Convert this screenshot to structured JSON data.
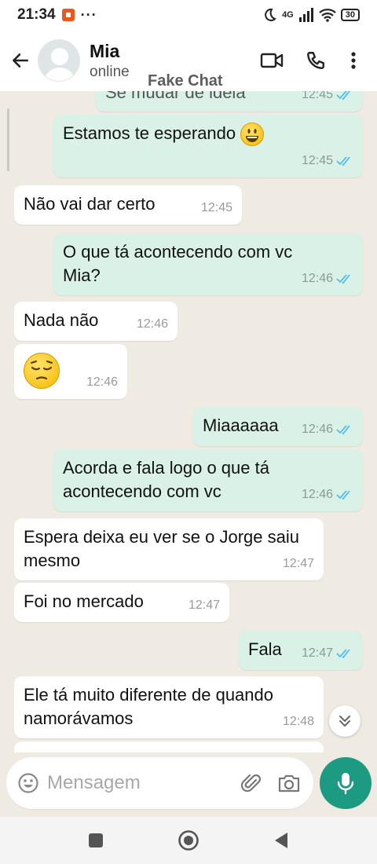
{
  "status_bar": {
    "time": "21:34",
    "dots": "···",
    "network": "4G",
    "battery": "30"
  },
  "header": {
    "contact_name": "Mia",
    "contact_status": "online",
    "watermark": "Fake Chat"
  },
  "messages": [
    {
      "dir": "out",
      "text": "Se mudar de ideia",
      "time": "12:45",
      "read": true
    },
    {
      "dir": "out",
      "text": "Estamos te esperando",
      "emoji": "grinning",
      "time": "12:45",
      "read": true
    },
    {
      "dir": "in",
      "text": "Não vai dar certo",
      "time": "12:45"
    },
    {
      "dir": "out",
      "text": "O que tá acontecendo com vc Mia?",
      "time": "12:46",
      "read": true
    },
    {
      "dir": "in",
      "text": "Nada não",
      "time": "12:46"
    },
    {
      "dir": "in",
      "text": "",
      "emoji": "pensive",
      "time": "12:46"
    },
    {
      "dir": "out",
      "text": "Miaaaaaa",
      "time": "12:46",
      "read": true
    },
    {
      "dir": "out",
      "text": "Acorda e fala logo o que tá acontecendo com vc",
      "time": "12:46",
      "read": true
    },
    {
      "dir": "in",
      "text": "Espera deixa eu ver se o Jorge saiu mesmo",
      "time": "12:47"
    },
    {
      "dir": "in",
      "text": "Foi no mercado",
      "time": "12:47"
    },
    {
      "dir": "out",
      "text": "Fala",
      "time": "12:47",
      "read": true
    },
    {
      "dir": "in",
      "text": "Ele tá muito diferente de quando namorávamos",
      "time": "12:48"
    }
  ],
  "input": {
    "placeholder": "Mensagem"
  },
  "icons": {
    "back": "arrow-left-icon",
    "video": "video-call-icon",
    "call": "phone-icon",
    "menu": "more-vert-icon",
    "emoji": "emoji-icon",
    "attach": "paperclip-icon",
    "camera": "camera-icon",
    "mic": "mic-icon",
    "scroll_down": "chevron-double-down-icon"
  },
  "colors": {
    "accent": "#1d9a82",
    "outgoing_bubble": "#d9f1e6",
    "incoming_bubble": "#ffffff",
    "read_tick": "#53bdeb",
    "background": "#efeae2"
  }
}
